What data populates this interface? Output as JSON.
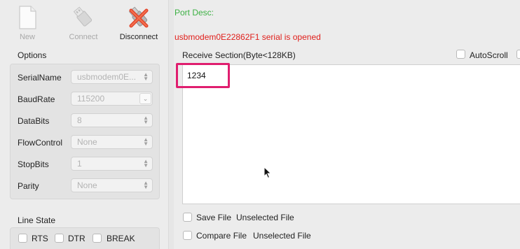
{
  "toolbar": {
    "new_label": "New",
    "connect_label": "Connect",
    "disconnect_label": "Disconnect"
  },
  "status": {
    "port_desc": "Port Desc:",
    "message": "usbmodem0E22862F1 serial is opened",
    "port_desc_color": "#3cb043",
    "message_color": "#e0201c"
  },
  "options": {
    "title": "Options",
    "rows": [
      {
        "label": "SerialName",
        "value": "usbmodem0E...",
        "control": "stepper"
      },
      {
        "label": "BaudRate",
        "value": "115200",
        "control": "dropdown"
      },
      {
        "label": "DataBits",
        "value": "8",
        "control": "stepper"
      },
      {
        "label": "FlowControl",
        "value": "None",
        "control": "stepper"
      },
      {
        "label": "StopBits",
        "value": "1",
        "control": "stepper"
      },
      {
        "label": "Parity",
        "value": "None",
        "control": "stepper"
      }
    ]
  },
  "line_state": {
    "title": "Line State",
    "items": [
      "RTS",
      "DTR",
      "BREAK"
    ]
  },
  "receive": {
    "title": "Receive Section(Byte<128KB)",
    "autoscroll_label": "AutoScroll",
    "content": "1234",
    "highlight_color": "#e01e6f"
  },
  "save_file": {
    "label": "Save File",
    "status": "Unselected File"
  },
  "compare_file": {
    "label": "Compare File",
    "status": "Unselected File"
  }
}
